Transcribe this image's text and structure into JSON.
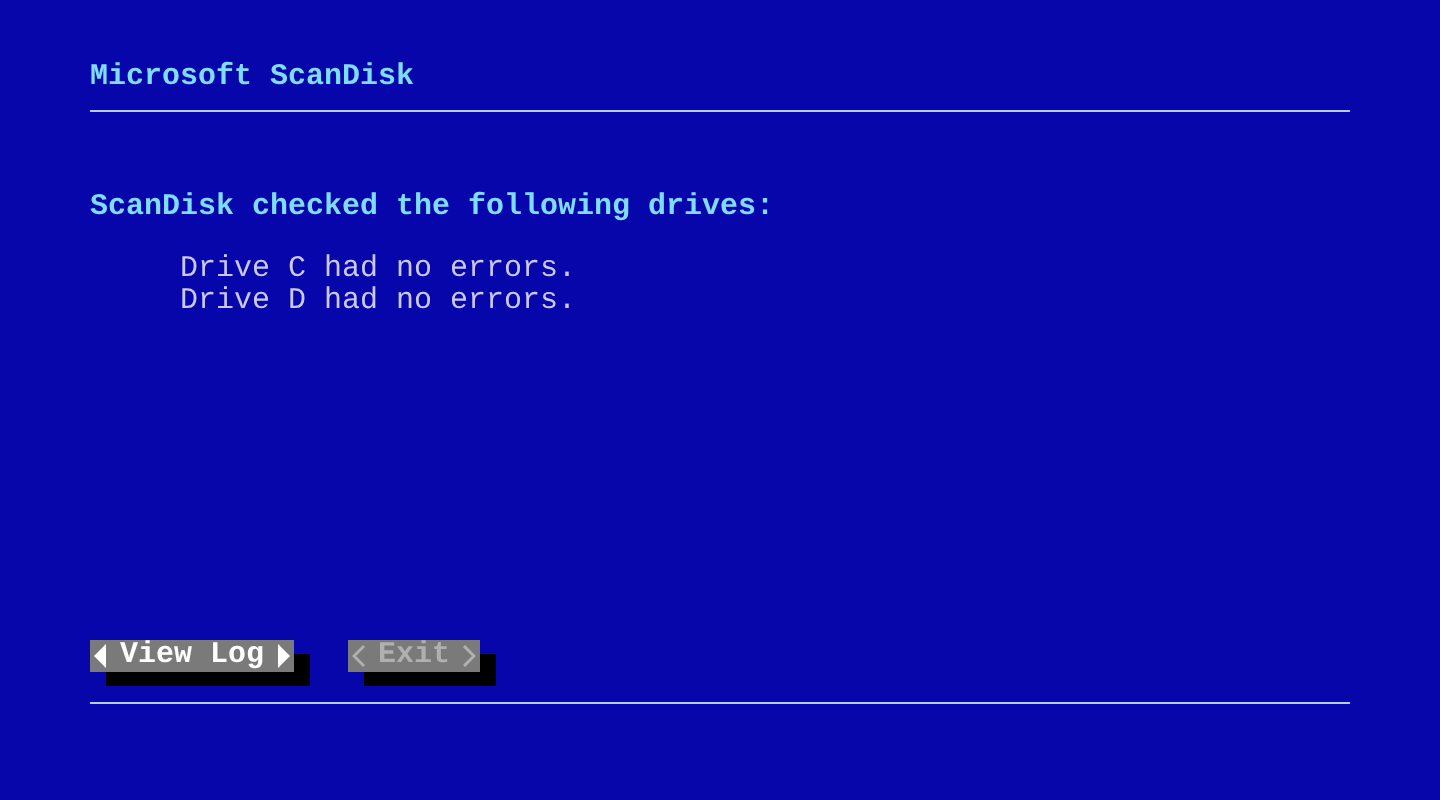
{
  "window": {
    "title": "Microsoft ScanDisk"
  },
  "message": "ScanDisk checked the following drives:",
  "results": [
    "Drive C had no errors.",
    "Drive D had no errors."
  ],
  "buttons": [
    {
      "label": "View Log",
      "selected": true,
      "disabled": false
    },
    {
      "label": "Exit",
      "selected": false,
      "disabled": true
    }
  ]
}
